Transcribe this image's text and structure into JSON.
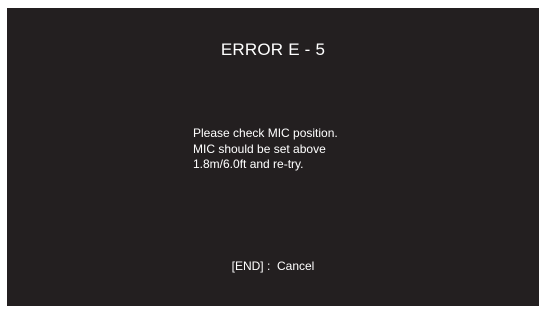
{
  "error": {
    "title": "ERROR E - 5",
    "message_lines": [
      "Please check MIC position.",
      "MIC should be set above",
      "1.8m/6.0ft and re-try."
    ],
    "footer_hint": "[END] :  Cancel"
  },
  "colors": {
    "background": "#231f20",
    "text": "#ffffff"
  }
}
